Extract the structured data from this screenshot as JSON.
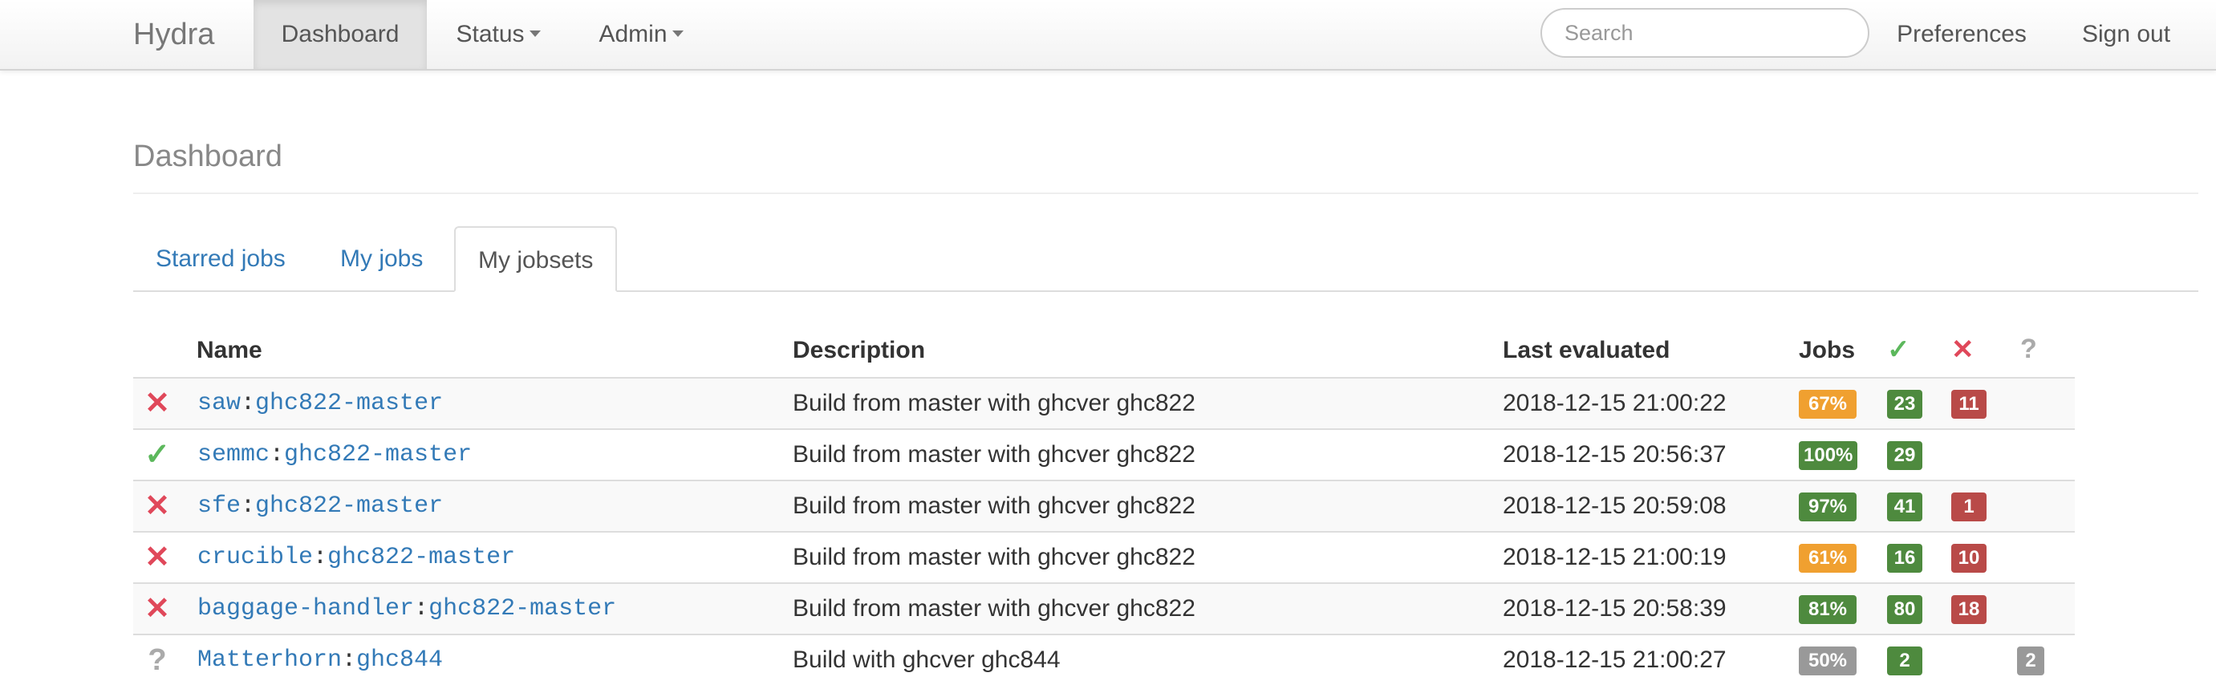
{
  "colors": {
    "link": "#337ab7",
    "success": "#4e8a3e",
    "warning": "#f0a030",
    "danger": "#b94a48",
    "neutral": "#999999",
    "fail_icon": "#e0485a",
    "ok_icon": "#5cb85c"
  },
  "navbar": {
    "brand": "Hydra",
    "items": [
      {
        "label": "Dashboard",
        "active": true
      },
      {
        "label": "Status",
        "dropdown": true
      },
      {
        "label": "Admin",
        "dropdown": true
      }
    ],
    "search_placeholder": "Search",
    "preferences": "Preferences",
    "sign_out": "Sign out"
  },
  "page": {
    "title": "Dashboard",
    "tabs": [
      {
        "label": "Starred jobs",
        "active": false
      },
      {
        "label": "My jobs",
        "active": false
      },
      {
        "label": "My jobsets",
        "active": true
      }
    ]
  },
  "table": {
    "headers": {
      "name": "Name",
      "description": "Description",
      "last_evaluated": "Last evaluated",
      "jobs": "Jobs",
      "succeeded_icon": "✓",
      "failed_icon": "✕",
      "unknown_icon": "?"
    },
    "rows": [
      {
        "status": "failed",
        "status_icon": "✕",
        "project": "saw",
        "jobset": "ghc822-master",
        "description": "Build from master with ghcver ghc822",
        "last_evaluated": "2018-12-15 21:00:22",
        "percent": "67%",
        "succeeded": "23",
        "failed": "11",
        "unknown": ""
      },
      {
        "status": "succeeded",
        "status_icon": "✓",
        "project": "semmc",
        "jobset": "ghc822-master",
        "description": "Build from master with ghcver ghc822",
        "last_evaluated": "2018-12-15 20:56:37",
        "percent": "100%",
        "succeeded": "29",
        "failed": "",
        "unknown": ""
      },
      {
        "status": "failed",
        "status_icon": "✕",
        "project": "sfe",
        "jobset": "ghc822-master",
        "description": "Build from master with ghcver ghc822",
        "last_evaluated": "2018-12-15 20:59:08",
        "percent": "97%",
        "succeeded": "41",
        "failed": "1",
        "unknown": ""
      },
      {
        "status": "failed",
        "status_icon": "✕",
        "project": "crucible",
        "jobset": "ghc822-master",
        "description": "Build from master with ghcver ghc822",
        "last_evaluated": "2018-12-15 21:00:19",
        "percent": "61%",
        "succeeded": "16",
        "failed": "10",
        "unknown": ""
      },
      {
        "status": "failed",
        "status_icon": "✕",
        "project": "baggage-handler",
        "jobset": "ghc822-master",
        "description": "Build from master with ghcver ghc822",
        "last_evaluated": "2018-12-15 20:58:39",
        "percent": "81%",
        "succeeded": "80",
        "failed": "18",
        "unknown": ""
      },
      {
        "status": "unknown",
        "status_icon": "?",
        "project": "Matterhorn",
        "jobset": "ghc844",
        "description": "Build with ghcver ghc844",
        "last_evaluated": "2018-12-15 21:00:27",
        "percent": "50%",
        "succeeded": "2",
        "failed": "",
        "unknown": "2"
      }
    ]
  }
}
